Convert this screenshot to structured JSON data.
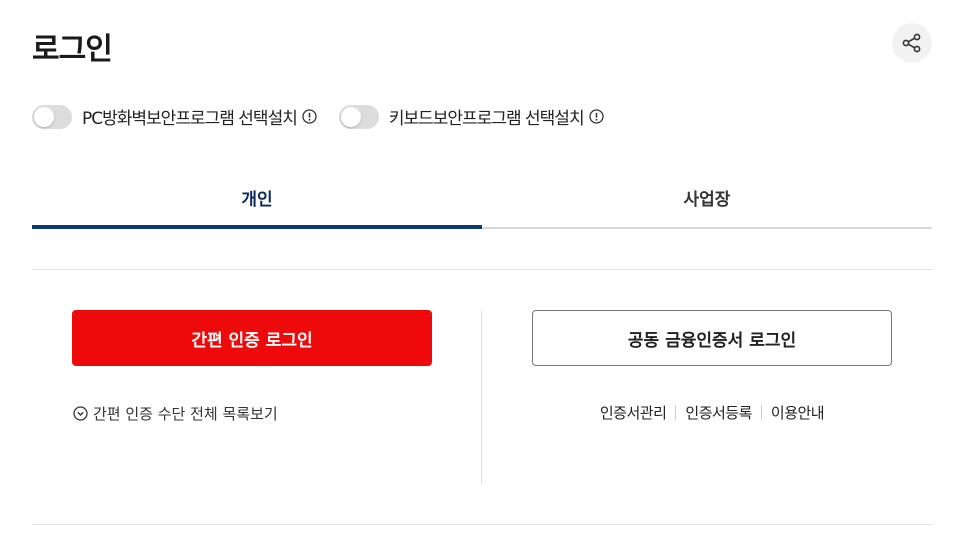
{
  "header": {
    "title": "로그인",
    "share_icon": "share-icon"
  },
  "toggles": [
    {
      "label": "PC방화벽보안프로그램 선택설치",
      "on": false
    },
    {
      "label": "키보드보안프로그램 선택설치",
      "on": false
    }
  ],
  "tabs": [
    {
      "label": "개인",
      "active": true
    },
    {
      "label": "사업장",
      "active": false
    }
  ],
  "personal": {
    "simple_login_label": "간편 인증 로그인",
    "show_all_methods_label": "간편 인증 수단 전체 목록보기",
    "cert_login_label": "공동 금융인증서 로그인",
    "cert_links": [
      "인증서관리",
      "인증서등록",
      "이용안내"
    ]
  },
  "colors": {
    "primary_red": "#ee0a0a",
    "active_tab": "#0b3a6e"
  }
}
